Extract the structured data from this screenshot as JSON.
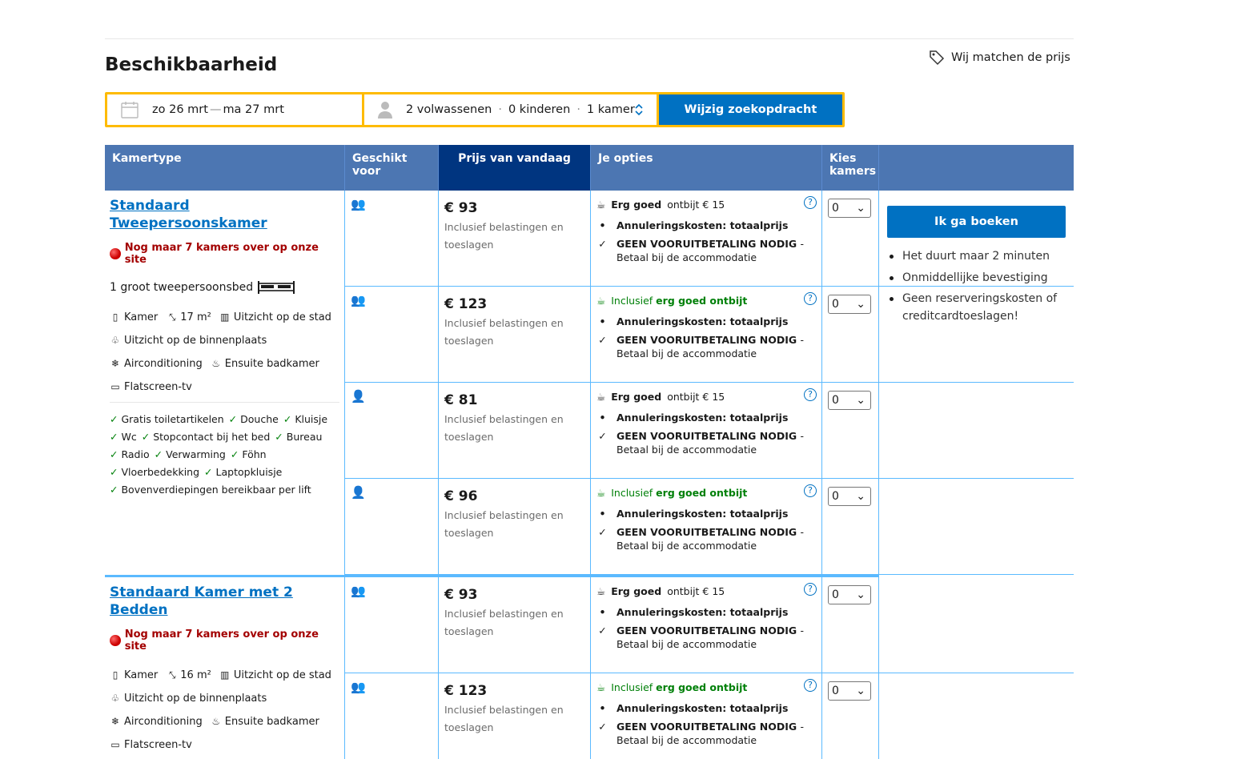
{
  "header": {
    "title": "Beschikbaarheid",
    "price_match": "Wij matchen de prijs"
  },
  "search": {
    "date_from": "zo 26 mrt",
    "date_sep": "—",
    "date_to": "ma 27 mrt",
    "adults": "2 volwassenen",
    "children": "0 kinderen",
    "rooms": "1 kamer",
    "dot": "·",
    "button": "Wijzig zoekopdracht"
  },
  "table": {
    "headers": [
      "Kamertype",
      "Geschikt voor",
      "Prijs van vandaag",
      "Je opties",
      "Kies kamers"
    ]
  },
  "rooms": [
    {
      "name": "Standaard Tweepersoonskamer",
      "scarcity": "Nog maar 7 kamers over op onze site",
      "bed": "1 groot tweepersoonsbed",
      "facilities": [
        "Kamer",
        "17 m²",
        "Uitzicht op de stad",
        "Uitzicht op de binnenplaats",
        "Airconditioning",
        "Ensuite badkamer",
        "Flatscreen-tv"
      ],
      "amenities": [
        "Gratis toiletartikelen",
        "Douche",
        "Kluisje",
        "Wc",
        "Stopcontact bij het bed",
        "Bureau",
        "Radio",
        "Verwarming",
        "Föhn",
        "Vloerbedekking",
        "Laptopkluisje",
        "Bovenverdiepingen bereikbaar per lift"
      ]
    },
    {
      "name": "Standaard Kamer met 2 Bedden",
      "scarcity": "Nog maar 7 kamers over op onze site",
      "facilities": [
        "Kamer",
        "16 m²",
        "Uitzicht op de stad",
        "Uitzicht op de binnenplaats",
        "Airconditioning",
        "Ensuite badkamer",
        "Flatscreen-tv"
      ]
    }
  ],
  "options": {
    "tax_note": "Inclusief belastingen en toeslagen",
    "breakfast_paid_strong": "Erg goed",
    "breakfast_paid_rest": "ontbijt € 15",
    "breakfast_incl_pre": "Inclusief",
    "breakfast_incl_strong": "erg goed ontbijt",
    "cancel": "Annuleringskosten: totaalprijs",
    "nopay": "GEEN VOORUITBETALING NODIG",
    "nopay_dash": "-",
    "pay_at": "Betaal bij de accommodatie",
    "prices": [
      "€ 93",
      "€ 123",
      "€ 81",
      "€ 96",
      "€ 93",
      "€ 123"
    ],
    "select_value": "0",
    "help": "?"
  },
  "booking": {
    "button": "Ik ga boeken",
    "points": [
      "Het duurt maar 2 minuten",
      "Onmiddellijke bevestiging",
      "Geen reserveringskosten of creditcardtoeslagen!"
    ]
  }
}
